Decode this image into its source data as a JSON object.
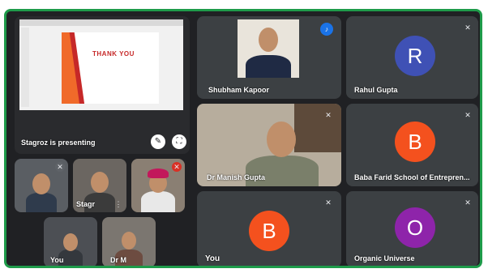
{
  "presentation": {
    "slide_title": "THANK YOU",
    "presenting_label": "Stagroz is presenting"
  },
  "small_tiles": [
    {
      "name": ""
    },
    {
      "name": "Stagr"
    },
    {
      "name": ""
    },
    {
      "name": "You"
    },
    {
      "name": "Dr M"
    }
  ],
  "participants": [
    {
      "name": "Shubham Kapoor",
      "type": "video"
    },
    {
      "name": "Rahul Gupta",
      "type": "avatar",
      "initial": "R",
      "color": "#3f51b5"
    },
    {
      "name": "Dr Manish Gupta",
      "type": "video"
    },
    {
      "name": "Baba Farid School of Entrepren...",
      "type": "avatar",
      "initial": "B",
      "color": "#f4511e"
    },
    {
      "name": "You",
      "type": "avatar",
      "initial": "B",
      "color": "#f4511e"
    },
    {
      "name": "Organic Universe",
      "type": "avatar",
      "initial": "O",
      "color": "#8e24aa"
    }
  ],
  "colors": {
    "frame_border": "#1e9b4a",
    "speaking": "#1a73e8",
    "background": "#202124"
  }
}
